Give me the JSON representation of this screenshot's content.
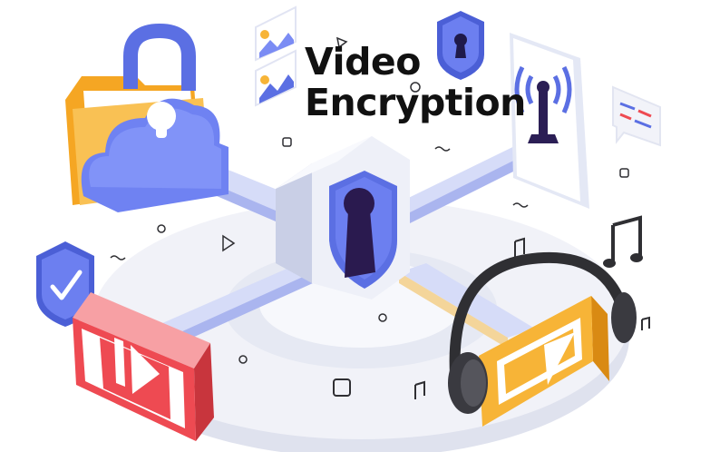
{
  "title": {
    "line1": "Video",
    "line2": "Encryption"
  },
  "icons": {
    "center": "keyhole-shield-icon",
    "folder": "cloud-lock-folder-icon",
    "video": "video-player-icon",
    "audio": "audio-player-headphones-icon",
    "antenna": "broadcast-antenna-icon",
    "chat": "chat-bubble-icon",
    "shield_check": "checkmark-shield-icon",
    "shield_key": "keyhole-shield-icon",
    "note": "music-note-icon"
  },
  "colors": {
    "primary": "#5b6fe3",
    "accent_orange": "#f7b437",
    "accent_red": "#ee4a52",
    "platform": "#e7eaf4",
    "ink": "#111111"
  }
}
